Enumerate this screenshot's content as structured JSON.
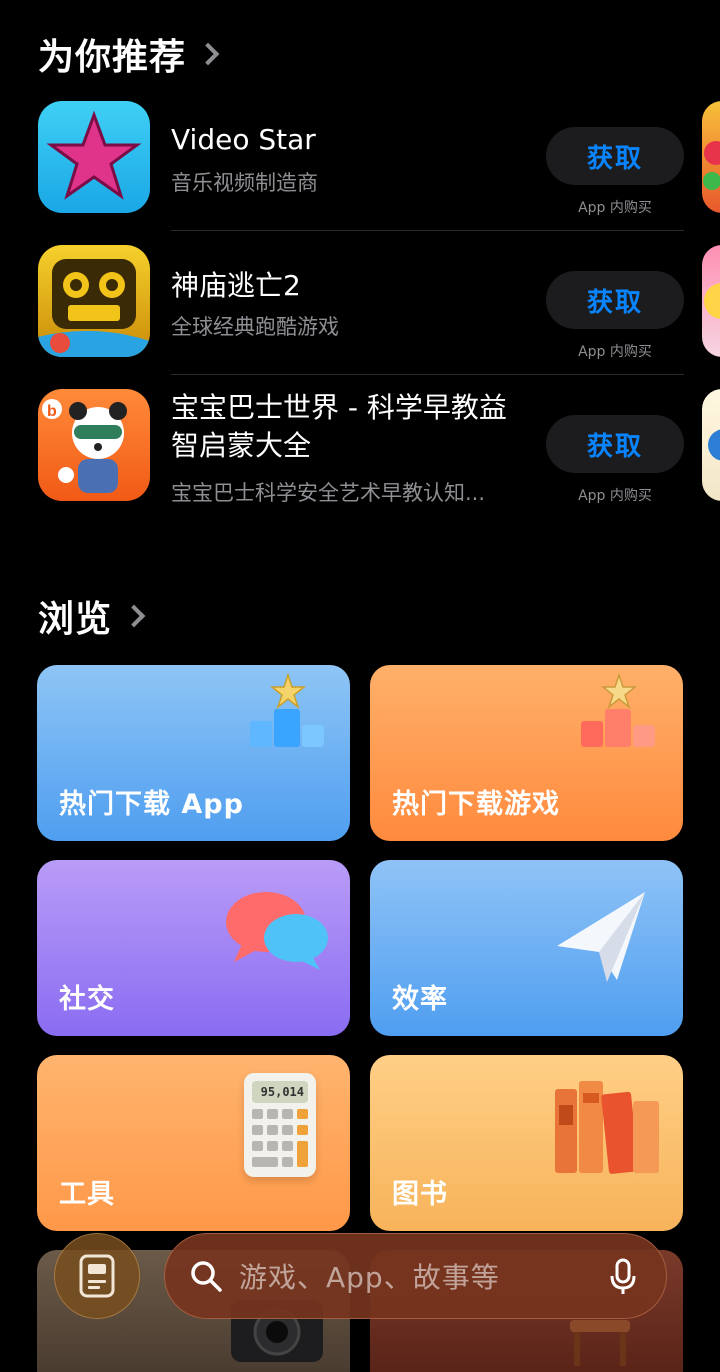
{
  "recommend": {
    "title": "为你推荐",
    "apps": [
      {
        "name": "Video Star",
        "subtitle": "音乐视频制造商",
        "button": "获取",
        "note": "App 内购买"
      },
      {
        "name": "神庙逃亡2",
        "subtitle": "全球经典跑酷游戏",
        "button": "获取",
        "note": "App 内购买"
      },
      {
        "name": "宝宝巴士世界 - 科学早教益智启蒙大全",
        "subtitle": "宝宝巴士科学安全艺术早教认知...",
        "button": "获取",
        "note": "App 内购买"
      }
    ]
  },
  "browse": {
    "title": "浏览",
    "tiles": [
      {
        "label": "热门下载 App",
        "color_top": "#8ec5f5",
        "color_bottom": "#4f9ef0",
        "icon": "podium-star-icon"
      },
      {
        "label": "热门下载游戏",
        "color_top": "#ffb06a",
        "color_bottom": "#ff8a3d",
        "icon": "podium-star-icon"
      },
      {
        "label": "社交",
        "color_top": "#b99cf7",
        "color_bottom": "#8a6cf2",
        "icon": "chat-bubbles-icon"
      },
      {
        "label": "效率",
        "color_top": "#8fc3f7",
        "color_bottom": "#4f9ef0",
        "icon": "paper-plane-icon"
      },
      {
        "label": "工具",
        "color_top": "#ffb46e",
        "color_bottom": "#ff9848",
        "icon": "calculator-icon"
      },
      {
        "label": "图书",
        "color_top": "#ffcf86",
        "color_bottom": "#f7b35a",
        "icon": "books-icon"
      }
    ],
    "calculator_display": "95,014"
  },
  "bottom_bar": {
    "search_placeholder": "游戏、App、故事等",
    "left_icon": "today-icon",
    "right_icon": "microphone-icon"
  }
}
